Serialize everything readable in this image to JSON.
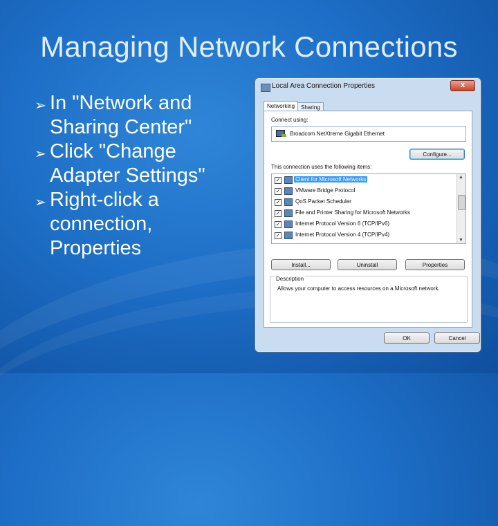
{
  "slide": {
    "title": "Managing Network Connections",
    "bullets": [
      {
        "arrow": "➢",
        "text": "In \"Network and Sharing Center\""
      },
      {
        "arrow": "➢",
        "text": "Click \"Change Adapter Settings\""
      },
      {
        "arrow": "➢",
        "text": "Right-click a connection, Properties"
      }
    ]
  },
  "dialog": {
    "title": "Local Area Connection Properties",
    "close_label": "x",
    "tabs": [
      "Networking",
      "Sharing"
    ],
    "connect_using_label": "Connect using:",
    "adapter_name": "Broadcom NetXtreme Gigabit Ethernet",
    "configure_label": "Configure...",
    "items_label": "This connection uses the following items:",
    "items": [
      {
        "text": "Client for Microsoft Networks",
        "checked": true,
        "selected": true
      },
      {
        "text": "VMware Bridge Protocol",
        "checked": true,
        "selected": false
      },
      {
        "text": "QoS Packet Scheduler",
        "checked": true,
        "selected": false
      },
      {
        "text": "File and Printer Sharing for Microsoft Networks",
        "checked": true,
        "selected": false
      },
      {
        "text": "Internet Protocol Version 6 (TCP/IPv6)",
        "checked": true,
        "selected": false
      },
      {
        "text": "Internet Protocol Version 4 (TCP/IPv4)",
        "checked": true,
        "selected": false
      }
    ],
    "install_label": "Install...",
    "uninstall_label": "Uninstall",
    "properties_label": "Properties",
    "description_title": "Description",
    "description_text": "Allows your computer to access resources on a Microsoft network.",
    "ok_label": "OK",
    "cancel_label": "Cancel",
    "check_glyph": "✓",
    "colors": {
      "selection": "#3399ff",
      "close_button": "#c8442a"
    }
  }
}
